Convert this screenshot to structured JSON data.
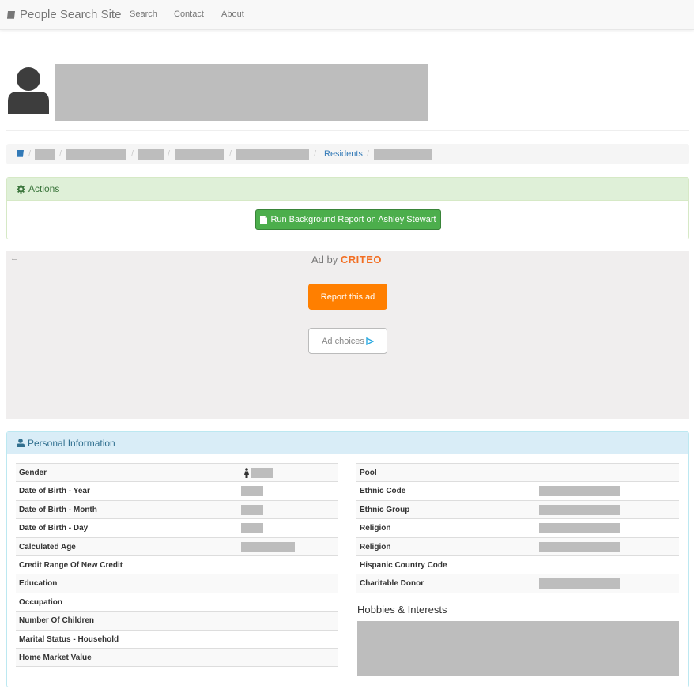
{
  "nav": {
    "brand": "People Search Site",
    "brand_icon": "book-icon",
    "links": [
      "Search",
      "Contact",
      "About"
    ]
  },
  "breadcrumb": {
    "home_icon": "book-icon",
    "residents": "Residents"
  },
  "actions": {
    "title": "Actions",
    "title_icon": "gear-icon",
    "button": "Run Background Report on Ashley Stewart",
    "button_icon": "document-icon"
  },
  "ad": {
    "back": "←",
    "ad_by": "Ad by ",
    "brand": "CRITEO",
    "report": "Report this ad",
    "choices": "Ad choices",
    "choices_icon": "ad-choices-icon"
  },
  "personal": {
    "title": "Personal Information",
    "title_icon": "user-icon",
    "left_rows": [
      "Gender",
      "Date of Birth - Year",
      "Date of Birth - Month",
      "Date of Birth - Day",
      "Calculated Age",
      "Credit Range Of New Credit",
      "Education",
      "Occupation",
      "Number Of Children",
      "Marital Status - Household",
      "Home Market Value"
    ],
    "right_rows": [
      "Pool",
      "Ethnic Code",
      "Ethnic Group",
      "Religion",
      "Religion",
      "Hispanic Country Code",
      "Charitable Donor"
    ],
    "gender_icon": "female-icon",
    "hobbies_title": "Hobbies & Interests"
  },
  "colors": {
    "redaction": "#bdbdbd",
    "success": "#4cae4c",
    "ad_orange": "#ff7f00",
    "link": "#337ab7"
  }
}
